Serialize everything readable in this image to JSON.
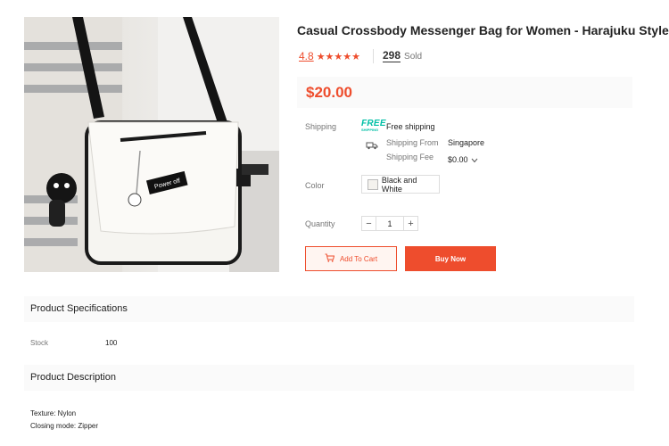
{
  "product": {
    "title": "Casual Crossbody Messenger Bag for Women - Harajuku Style",
    "rating": "4.8",
    "stars": "★★★★★",
    "sold_count": "298",
    "sold_label": "Sold",
    "price": "$20.00",
    "image_icon": "crossbody-bag-photo",
    "bag_tag_text": "Power off"
  },
  "shipping": {
    "label": "Shipping",
    "badge_top": "FREE",
    "badge_bottom": "SHIPPING",
    "free_text": "Free shipping",
    "from_label": "Shipping From",
    "from_value": "Singapore",
    "fee_label": "Shipping Fee",
    "fee_value": "$0.00",
    "icon": "truck-icon"
  },
  "color": {
    "label": "Color",
    "selected": "Black and White"
  },
  "quantity": {
    "label": "Quantity",
    "minus": "−",
    "value": "1",
    "plus": "+"
  },
  "actions": {
    "add_to_cart": "Add To Cart",
    "buy_now": "Buy Now",
    "cart_icon": "cart-plus-icon"
  },
  "specifications": {
    "title": "Product Specifications",
    "rows": [
      {
        "label": "Stock",
        "value": "100"
      }
    ]
  },
  "description": {
    "title": "Product Description",
    "lines": [
      "Texture: Nylon",
      "Closing mode: Zipper"
    ]
  },
  "colors": {
    "accent": "#ee4d2d",
    "free_shipping": "#00bfa5",
    "section_bg": "#fafafa"
  }
}
